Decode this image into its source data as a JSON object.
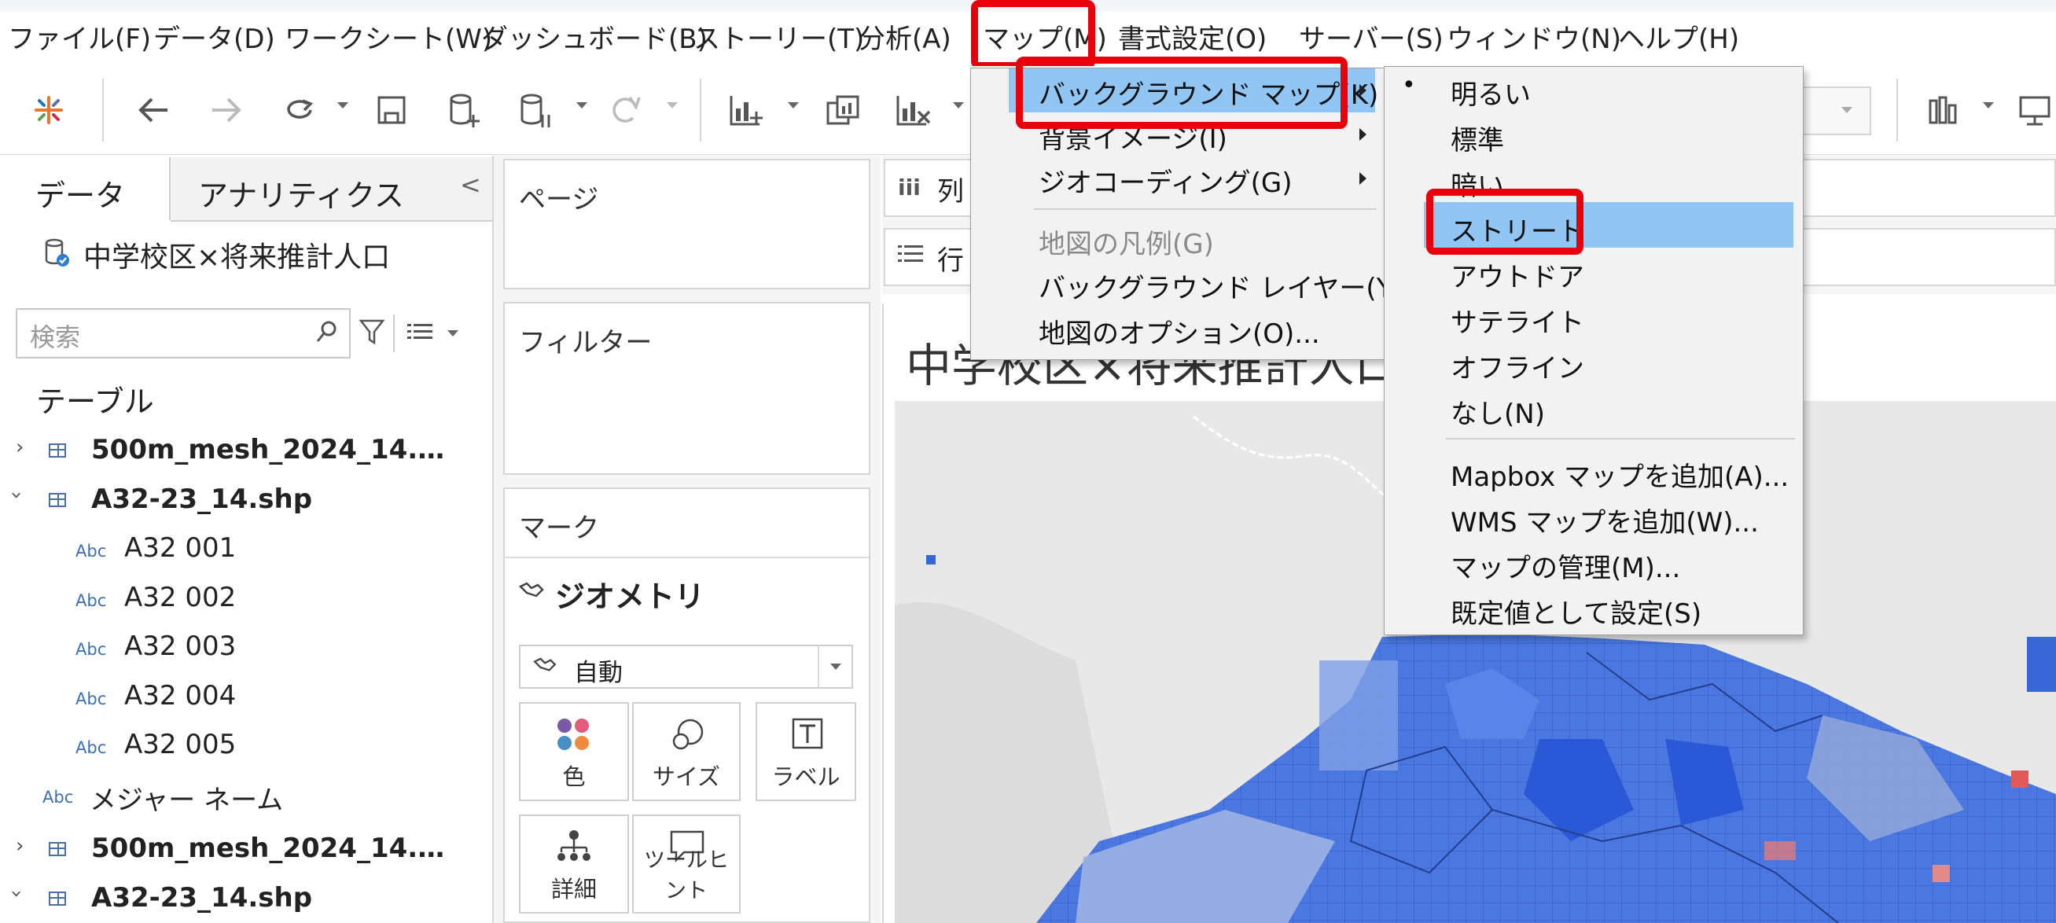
{
  "menubar": {
    "items": [
      "ファイル(F)",
      "データ(D)",
      "ワークシート(W)",
      "ダッシュボード(B)",
      "ストーリー(T)",
      "分析(A)",
      "マップ(M)",
      "書式設定(O)",
      "サーバー(S)",
      "ウィンドウ(N)",
      "ヘルプ(H)"
    ]
  },
  "left_pane": {
    "tab_data": "データ",
    "tab_analytics": "アナリティクス",
    "collapse": "<",
    "datasource": "中学校区×将来推計人口",
    "search_placeholder": "検索",
    "tables_heading": "テーブル",
    "tree": [
      {
        "type": "table",
        "label": "500m_mesh_2024_14.…",
        "expanded": false
      },
      {
        "type": "table",
        "label": "A32-23_14.shp",
        "expanded": true
      },
      {
        "type": "field",
        "badge": "Abc",
        "label": "A32 001"
      },
      {
        "type": "field",
        "badge": "Abc",
        "label": "A32 002"
      },
      {
        "type": "field",
        "badge": "Abc",
        "label": "A32 003"
      },
      {
        "type": "field",
        "badge": "Abc",
        "label": "A32 004"
      },
      {
        "type": "field",
        "badge": "Abc",
        "label": "A32 005"
      },
      {
        "type": "measure-names",
        "badge": "Abc",
        "label": "メジャー ネーム"
      },
      {
        "type": "table",
        "label": "500m_mesh_2024_14.…",
        "expanded": false
      },
      {
        "type": "table",
        "label": "A32-23_14.shp",
        "expanded": true
      }
    ]
  },
  "shelves": {
    "pages": "ページ",
    "filters": "フィルター",
    "marks": "マーク",
    "marks_type": "ジオメトリ",
    "mark_select": "自動",
    "columns_label": "列",
    "rows_label": "行",
    "mark_buttons": [
      "色",
      "サイズ",
      "ラベル",
      "詳細",
      "ツールヒント"
    ]
  },
  "worksheet_title": "中学校区×将来推計人口",
  "map_menu": {
    "items": [
      {
        "label": "バックグラウンド マップ(K)",
        "submenu": true,
        "highlighted": true
      },
      {
        "label": "背景イメージ(I)",
        "submenu": true
      },
      {
        "label": "ジオコーディング(G)",
        "submenu": true
      },
      {
        "label": "地図の凡例(G)",
        "disabled": true
      },
      {
        "label": "バックグラウンド レイヤー(Y)..."
      },
      {
        "label": "地図のオプション(O)..."
      }
    ]
  },
  "bg_map_submenu": {
    "bullet": "•",
    "styles": [
      "明るい",
      "標準",
      "暗い",
      "ストリート",
      "アウトドア",
      "サテライト",
      "オフライン",
      "なし(N)"
    ],
    "checked": "明るい",
    "highlighted": "ストリート",
    "actions": [
      "Mapbox マップを追加(A)...",
      "WMS マップを追加(W)...",
      "マップの管理(M)...",
      "既定値として設定(S)"
    ]
  },
  "colors": {
    "highlight": "#91c6f4",
    "callout": "#e8000b",
    "map_blue": "#3a67d8"
  }
}
